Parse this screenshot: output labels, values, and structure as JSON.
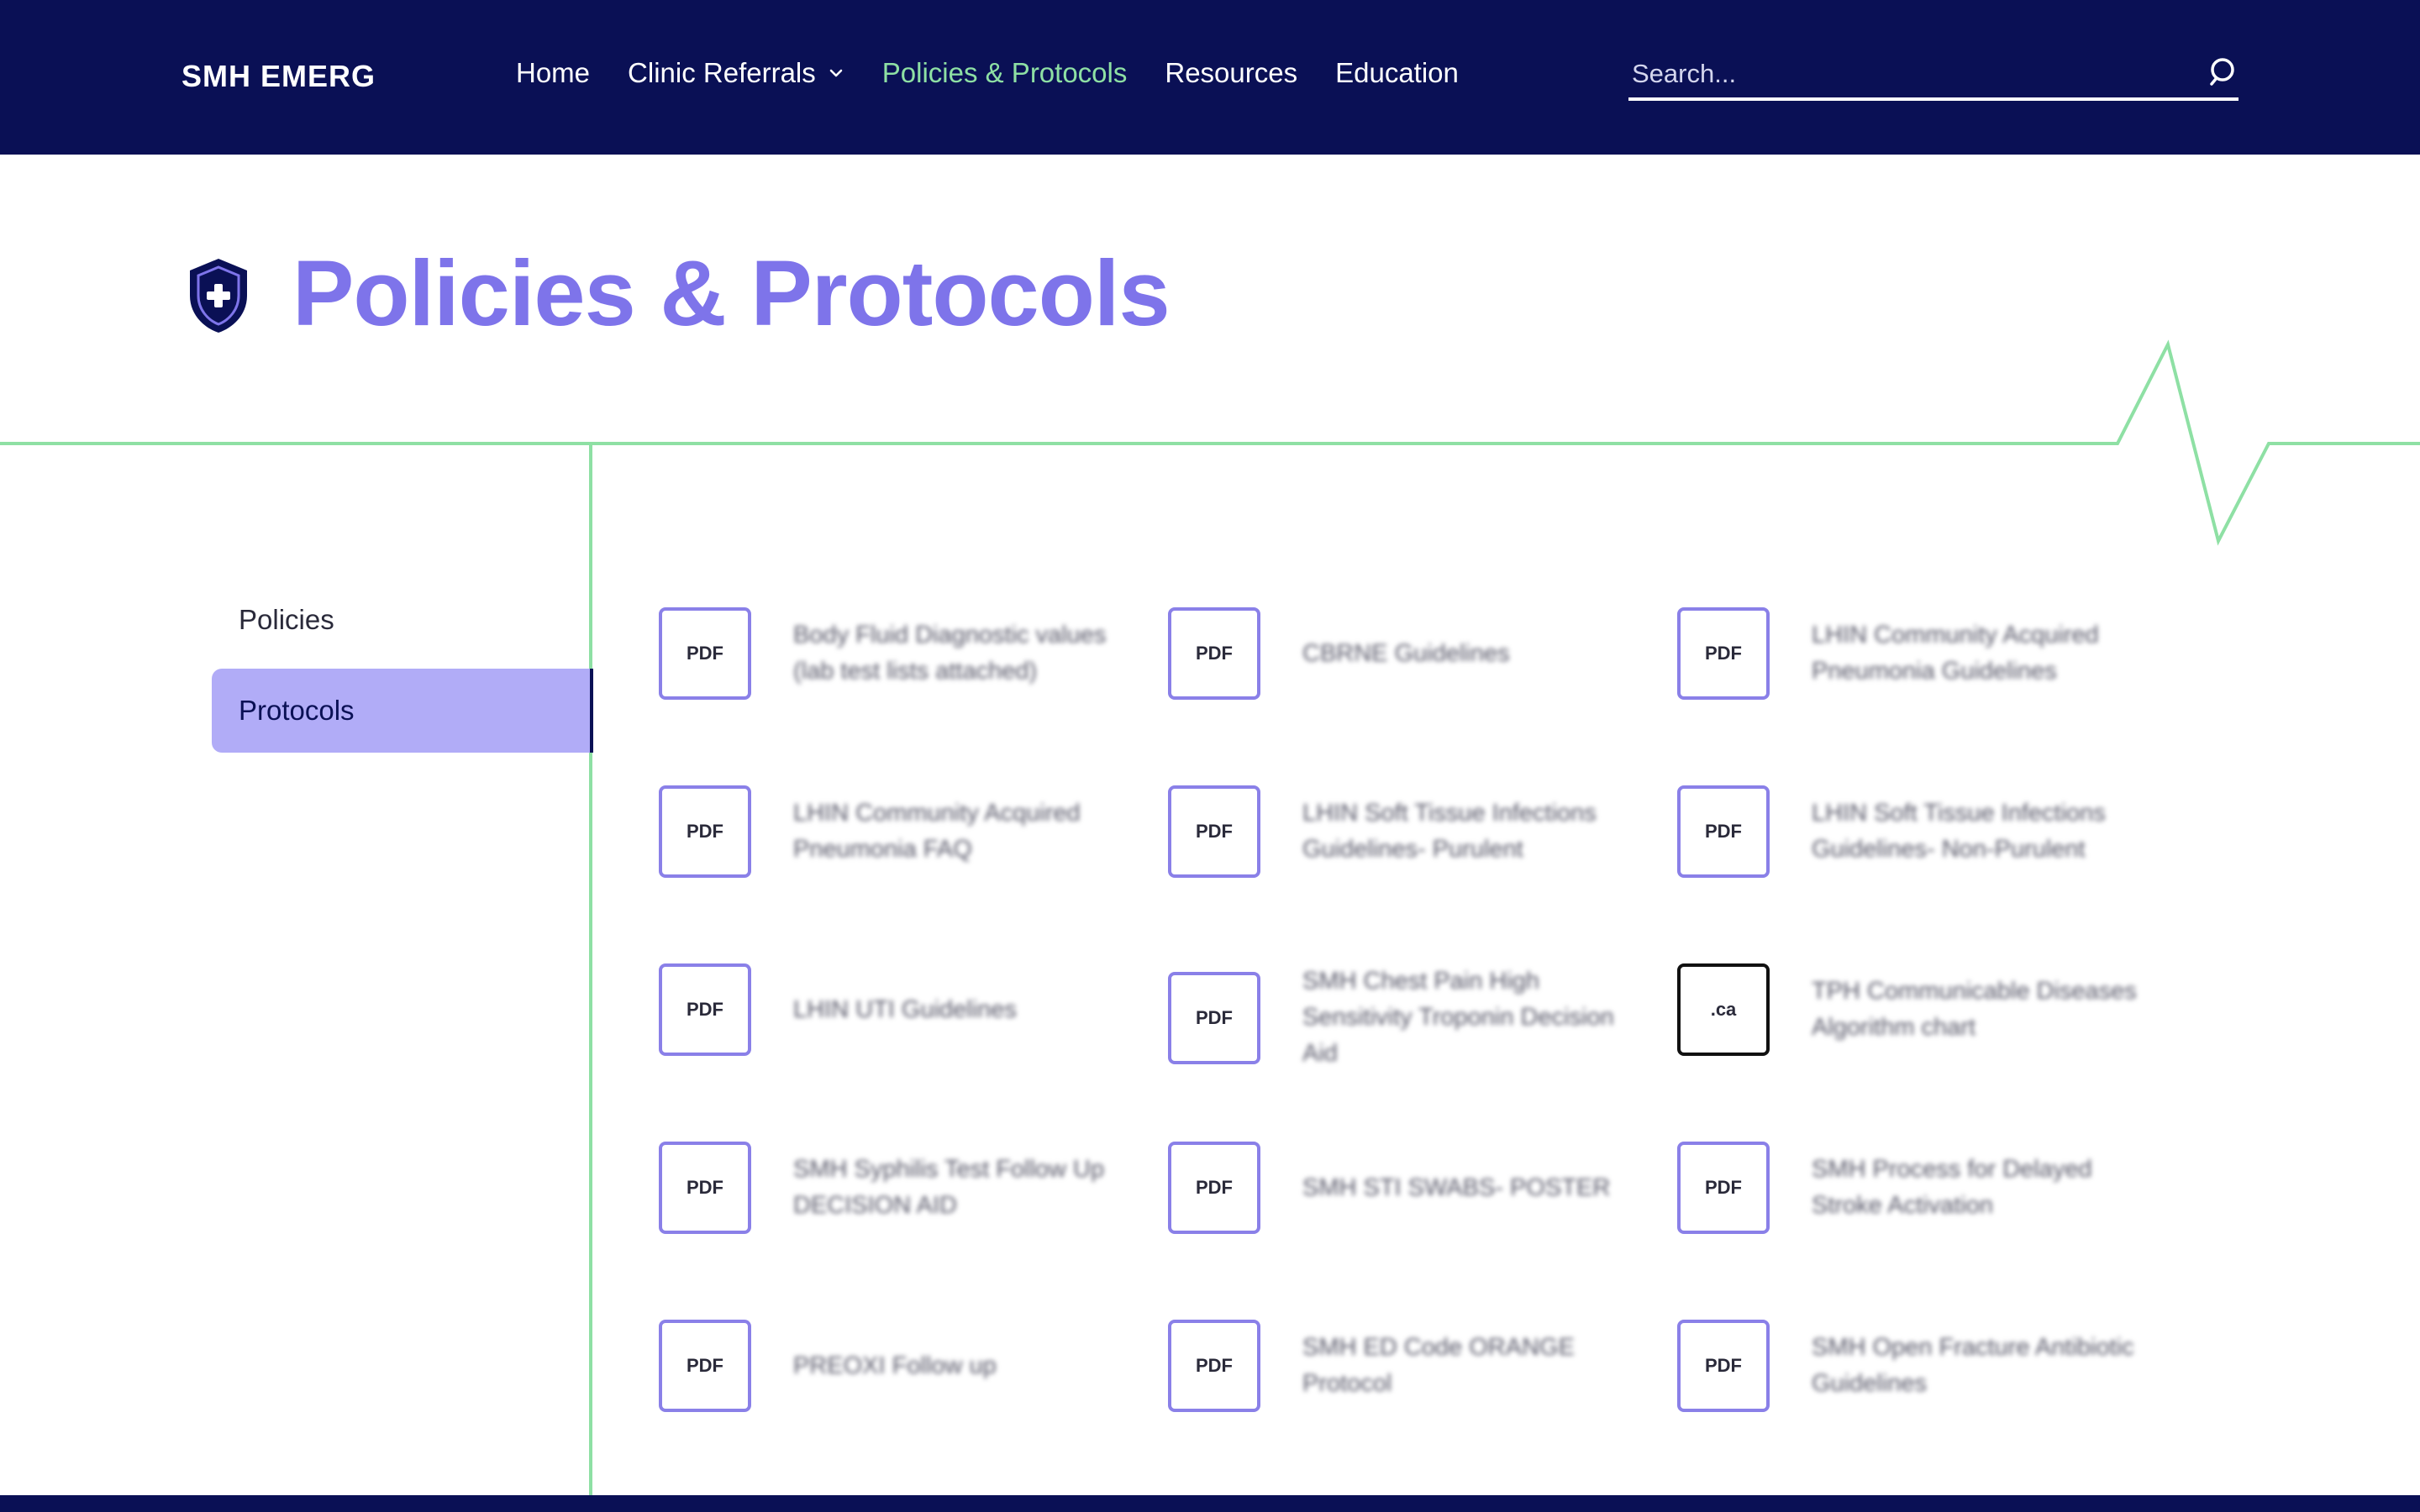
{
  "header": {
    "brand": "SMH EMERG",
    "nav": [
      {
        "label": "Home"
      },
      {
        "label": "Clinic Referrals",
        "has_dropdown": true
      },
      {
        "label": "Policies & Protocols",
        "active": true
      },
      {
        "label": "Resources"
      },
      {
        "label": "Education"
      }
    ],
    "search_placeholder": "Search..."
  },
  "page": {
    "title": "Policies & Protocols",
    "title_icon": "shield-plus-icon"
  },
  "sidebar": {
    "items": [
      {
        "label": "Policies",
        "active": false
      },
      {
        "label": "Protocols",
        "active": true
      }
    ]
  },
  "documents": [
    {
      "badge": "PDF",
      "label": "Body Fluid Diagnostic values (lab test lists attached)"
    },
    {
      "badge": "PDF",
      "label": "CBRNE Guidelines"
    },
    {
      "badge": "PDF",
      "label": "LHIN Community Acquired Pneumonia Guidelines"
    },
    {
      "badge": "PDF",
      "label": "LHIN Community Acquired Pneumonia FAQ"
    },
    {
      "badge": "PDF",
      "label": "LHIN Soft Tissue Infections Guidelines- Purulent"
    },
    {
      "badge": "PDF",
      "label": "LHIN Soft Tissue Infections Guidelines- Non-Purulent"
    },
    {
      "badge": "PDF",
      "label": "LHIN UTI Guidelines"
    },
    {
      "badge": "PDF",
      "label": "SMH Chest Pain High Sensitivity Troponin Decision Aid"
    },
    {
      "badge": ".ca",
      "label": "TPH Communicable Diseases Algorithm chart"
    },
    {
      "badge": "PDF",
      "label": "SMH Syphilis Test Follow Up DECISION AID"
    },
    {
      "badge": "PDF",
      "label": "SMH STI SWABS- POSTER"
    },
    {
      "badge": "PDF",
      "label": "SMH Process for Delayed Stroke Activation"
    },
    {
      "badge": "PDF",
      "label": "PREOXI Follow up"
    },
    {
      "badge": "PDF",
      "label": "SMH ED Code ORANGE Protocol"
    },
    {
      "badge": "PDF",
      "label": "SMH Open Fracture Antibiotic Guidelines"
    }
  ],
  "colors": {
    "header_bg": "#0a1055",
    "accent": "#7e74ea",
    "active_nav": "#8ee0a4",
    "pulse_line": "#8ee0a4",
    "sidebar_active_bg": "#b1acf7"
  }
}
